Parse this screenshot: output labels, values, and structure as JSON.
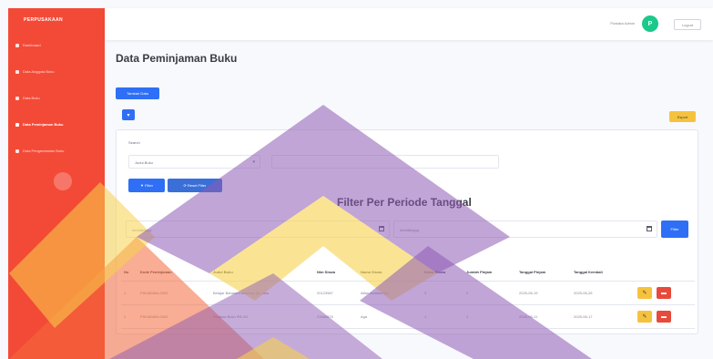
{
  "sidebar": {
    "brand": "PERPUSAKAAN",
    "items": [
      {
        "label": "Dashboard"
      },
      {
        "label": "Data Anggota Buku"
      },
      {
        "label": "Data Buku"
      },
      {
        "label": "Data Peminjaman Buku"
      },
      {
        "label": "Data Pengembalian Buku"
      }
    ]
  },
  "topbar": {
    "user_name": "Pustaka Admin",
    "avatar_initial": "P",
    "logout_label": "Logout"
  },
  "page": {
    "title": "Data Peminjaman Buku",
    "add_button": "Tambah Data",
    "export_button": "Export"
  },
  "filters": {
    "search_label": "Search",
    "select_value": "Judul Buku",
    "filter_button": "Filter",
    "reset_button": "Reset Filter",
    "period_title": "Filter Per Periode Tanggal",
    "date_from_placeholder": "mm/dd/yyyy",
    "date_to_placeholder": "mm/dd/yyyy",
    "date_filter_button": "Filter"
  },
  "table": {
    "headers": [
      "No",
      "Kode Peminjaman",
      "Judul Buku",
      "Nim Siswa",
      "Nama Siswa",
      "Kelas Siswa",
      "Jumlah Pinjam",
      "Tanggal Pinjam",
      "Tanggal Kembali",
      ""
    ],
    "rows": [
      [
        "1",
        "PINJAMAN-0001",
        "Belajar Bahasa Indonesia (3) Jaka",
        "20123987",
        "Alfan Auliarta Bar",
        "3",
        "2",
        "2025-06-19",
        "2025-06-26"
      ],
      [
        "2",
        "PINJAMAN-0002",
        "Ringkas Buku IPA 2G",
        "23486876",
        "Aga",
        "1",
        "1",
        "2025-06-11",
        "2025-06-17"
      ]
    ]
  },
  "colors": {
    "sidebar": "#f34a37",
    "primary": "#2e6ff6",
    "warning": "#f6c23e",
    "danger": "#e74a3b",
    "success": "#1cc88a",
    "watermark_purple": "#8e5bb4",
    "watermark_yellow": "#f7d24c"
  }
}
